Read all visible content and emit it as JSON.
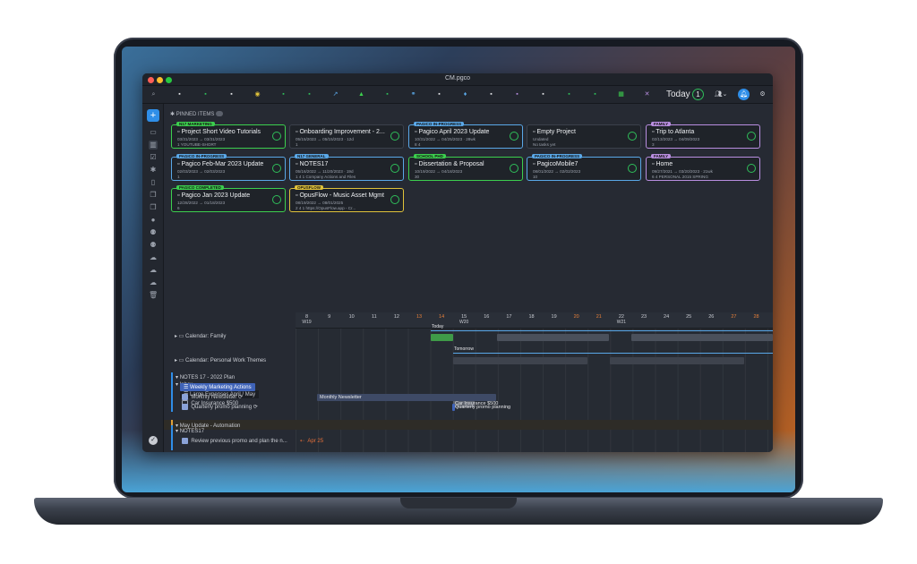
{
  "window": {
    "title": "CM.pgco"
  },
  "toolbar": {
    "today_label": "Today",
    "today_count": "1"
  },
  "pinned": {
    "label": "PINNED ITEMS",
    "cards": [
      {
        "tag": "N17 MARKETING",
        "tag_color": "#3ccf4e",
        "title": "Project Short Video Tutorials",
        "sub1": "03/31/2023 → 03/31/2023",
        "sub2": "1  YOUTUBE-SHORT"
      },
      {
        "tag": "",
        "tag_color": "",
        "title": "Onboarding Improvement - 2...",
        "sub1": "05/15/2023 → 05/15/2023 · 12d",
        "sub2": "1"
      },
      {
        "tag": "PAGICO IN-PROGRESS",
        "tag_color": "#5aa8e8",
        "title": "Pagico April 2023 Update",
        "sub1": "10/31/2022 → 04/25/2023 · 28wk",
        "sub2": "8  4"
      },
      {
        "tag": "",
        "tag_color": "",
        "title": "Empty Project",
        "sub1": "Undated",
        "sub2": "No tasks yet"
      },
      {
        "tag": "FAMILY",
        "tag_color": "#b98ee0",
        "title": "Trip to Atlanta",
        "sub1": "02/13/2023 → 04/09/2023",
        "sub2": "3"
      },
      {
        "tag": "PAGICO IN-PROGRESS",
        "tag_color": "#5aa8e8",
        "title": "Pagico Feb-Mar 2023 Update",
        "sub1": "02/03/2023 → 02/03/2023",
        "sub2": "1"
      },
      {
        "tag": "N17 GENERAL",
        "tag_color": "#5aa8e8",
        "title": "NOTES17",
        "sub1": "05/16/2022 → 11/20/2023 · 19d",
        "sub2": "1  4  1  Company Actions and Files"
      },
      {
        "tag": "SCHOOL PHD",
        "tag_color": "#3ccf4e",
        "title": "Dissertation & Proposal",
        "sub1": "10/19/2022 → 04/18/2023",
        "sub2": "30"
      },
      {
        "tag": "PAGICO IN-PROGRESS",
        "tag_color": "#5aa8e8",
        "title": "PagicoMobile7",
        "sub1": "08/01/2022 → 02/02/2023",
        "sub2": "10"
      },
      {
        "tag": "FAMILY",
        "tag_color": "#b98ee0",
        "title": "Home",
        "sub1": "09/27/2021 → 03/20/2023 · 21wk",
        "sub2": "6  4  PERSONAL  2015 SPRING"
      },
      {
        "tag": "PAGICO COMPLETED",
        "tag_color": "#3ccf4e",
        "title": "Pagico Jan 2023 Update",
        "sub1": "12/28/2022 → 01/18/2023",
        "sub2": "6"
      },
      {
        "tag": "OPUSFLOW",
        "tag_color": "#e0c23a",
        "title": "OpusFlow - Music Asset Mgmt",
        "sub1": "08/19/2022 → 08/01/2025",
        "sub2": "2  4  1  https://OpusFlow.app - Cr..."
      }
    ]
  },
  "calendar": {
    "days": [
      {
        "d": "8",
        "w": "W19",
        "weekend": false
      },
      {
        "d": "9",
        "w": "",
        "weekend": false
      },
      {
        "d": "10",
        "w": "",
        "weekend": false
      },
      {
        "d": "11",
        "w": "",
        "weekend": false
      },
      {
        "d": "12",
        "w": "",
        "weekend": false
      },
      {
        "d": "13",
        "w": "",
        "weekend": true
      },
      {
        "d": "14",
        "w": "",
        "weekend": true
      },
      {
        "d": "15",
        "w": "W20",
        "weekend": false
      },
      {
        "d": "16",
        "w": "",
        "weekend": false
      },
      {
        "d": "17",
        "w": "",
        "weekend": false
      },
      {
        "d": "18",
        "w": "",
        "weekend": false
      },
      {
        "d": "19",
        "w": "",
        "weekend": false
      },
      {
        "d": "20",
        "w": "",
        "weekend": true
      },
      {
        "d": "21",
        "w": "",
        "weekend": true
      },
      {
        "d": "22",
        "w": "W21",
        "weekend": false
      },
      {
        "d": "23",
        "w": "",
        "weekend": false
      },
      {
        "d": "24",
        "w": "",
        "weekend": false
      },
      {
        "d": "25",
        "w": "",
        "weekend": false
      },
      {
        "d": "26",
        "w": "",
        "weekend": false
      },
      {
        "d": "27",
        "w": "",
        "weekend": true
      },
      {
        "d": "28",
        "w": "",
        "weekend": true
      }
    ],
    "today_label": "Today",
    "tomorrow_label": "Tomorrow",
    "rows": {
      "family": "Calendar: Family",
      "personal": "Calendar: Personal Work Themes",
      "inbox": "Inbox",
      "large_expenses": "Large Expenses April / May",
      "car_insurance": "Car Insurance $500",
      "may_update": "May Update - Automation",
      "notes_plan": "NOTES 17 - 2022 Plan",
      "weekly_marketing": "Weekly Marketing Actions",
      "monthly_newsletter": "Monthly Newsletter",
      "quarterly_promo": "Quarterly promo planning",
      "notes17": "NOTES17",
      "review_promo": "Review previous promo and plan the n...",
      "review_due": "Apr 25"
    },
    "bars": {
      "car_insurance": "Car Insurance $500",
      "monthly_newsletter": "Monthly Newsletter",
      "quarterly_promo": "Quarterly promo planning"
    }
  }
}
